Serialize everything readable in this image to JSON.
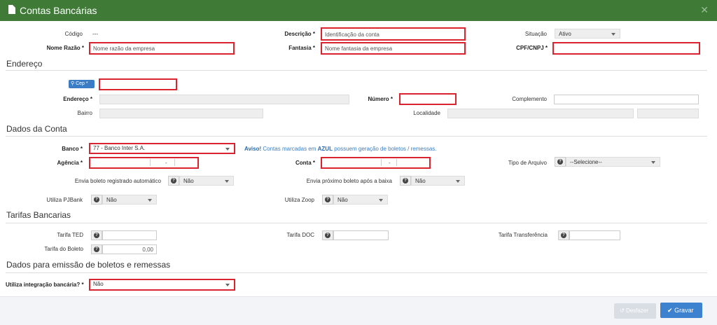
{
  "window": {
    "title": "Contas Bancárias"
  },
  "header_fields": {
    "codigo_label": "Código",
    "codigo_value": "---",
    "descricao_label": "Descrição *",
    "descricao_placeholder": "Identificação da conta",
    "situacao_label": "Situação",
    "situacao_value": "Ativo",
    "nome_razao_label": "Nome Razão *",
    "nome_razao_placeholder": "Nome razão da empresa",
    "fantasia_label": "Fantasia *",
    "fantasia_placeholder": "Nome fantasia da empresa",
    "cpf_cnpj_label": "CPF/CNPJ *"
  },
  "endereco": {
    "section_title": "Endereço",
    "cep_button": "Cep *",
    "endereco_label": "Endereço *",
    "numero_label": "Número *",
    "complemento_label": "Complemento",
    "bairro_label": "Bairro",
    "localidade_label": "Localidade"
  },
  "dados_conta": {
    "section_title": "Dados da Conta",
    "banco_label": "Banco *",
    "banco_value": "77 - Banco Inter S.A.",
    "aviso_prefix": "Aviso!",
    "aviso_mid": " Contas marcadas em ",
    "aviso_azul": "AZUL",
    "aviso_suffix": " possuem geração de boletos / remessas.",
    "agencia_label": "Agência *",
    "conta_label": "Conta *",
    "tipo_arquivo_label": "Tipo de Arquivo",
    "tipo_arquivo_value": "--Selecione--",
    "envia_auto_label": "Envia boleto registrado automático",
    "envia_auto_value": "Não",
    "envia_proximo_label": "Envia próximo boleto após a baixa",
    "envia_proximo_value": "Não",
    "pjbank_label": "Utiliza PJBank",
    "pjbank_value": "Não",
    "zoop_label": "Utiliza Zoop",
    "zoop_value": "Não",
    "dash": "-"
  },
  "tarifas": {
    "section_title": "Tarifas Bancarias",
    "ted_label": "Tarifa TED",
    "doc_label": "Tarifa DOC",
    "transferencia_label": "Tarifa Transferência",
    "boleto_label": "Tarifa do Boleto",
    "boleto_value": "0,00"
  },
  "emissao": {
    "section_title": "Dados para emissão de boletos e remessas",
    "integracao_label": "Utiliza integração bancária? *",
    "integracao_value": "Não"
  },
  "footer": {
    "desfazer": "Desfazer",
    "gravar": "Gravar"
  },
  "colors": {
    "title_bar": "#3f7a37",
    "required_border": "#d9232e",
    "primary": "#3c82cf"
  }
}
